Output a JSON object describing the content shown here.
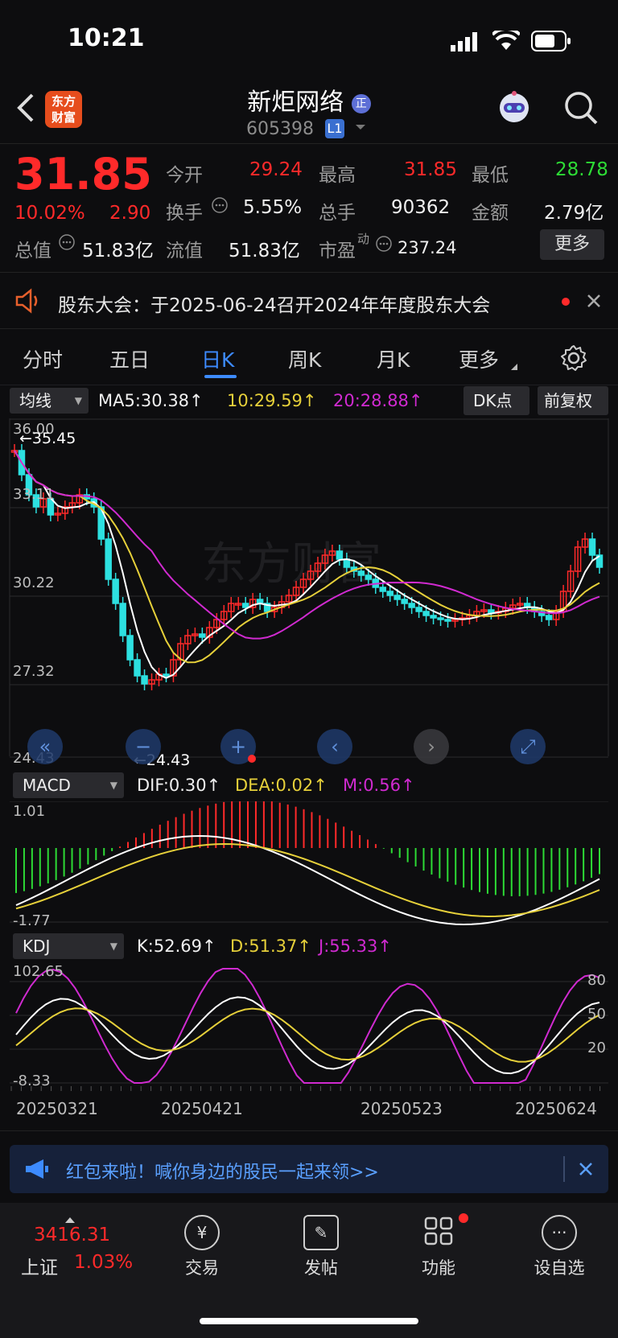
{
  "status": {
    "time": "10:21"
  },
  "header": {
    "logo": "东方\n财富",
    "title": "新炬网络",
    "code": "605398",
    "level": "L1"
  },
  "quote": {
    "price": "31.85",
    "change_pct": "10.02%",
    "change": "2.90",
    "fields": [
      {
        "label": "今开",
        "value": "29.24"
      },
      {
        "label": "最高",
        "value": "31.85"
      },
      {
        "label": "最低",
        "value": "28.78"
      },
      {
        "label": "换手",
        "value": "5.55%"
      },
      {
        "label": "总手",
        "value": "90362"
      },
      {
        "label": "金额",
        "value": "2.79亿"
      },
      {
        "label": "总值",
        "value": "51.83亿"
      },
      {
        "label": "流值",
        "value": "51.83亿"
      },
      {
        "label": "市盈",
        "sup": "动",
        "value": "237.24"
      }
    ],
    "more": "更多"
  },
  "notice": {
    "text": "股东大会：于2025-06-24召开2024年年度股东大会"
  },
  "tabs": [
    "分时",
    "五日",
    "日K",
    "周K",
    "月K",
    "更多"
  ],
  "active_tab": "日K",
  "kline": {
    "selector": "均线",
    "ma5": "MA5:30.38↑",
    "ma10": "10:29.59↑",
    "ma20": "20:28.88↑",
    "dk": "DK点",
    "adjust": "前复权",
    "y_labels": [
      "36.00",
      "33.11",
      "30.22",
      "27.32",
      "24.43"
    ],
    "high_mark": "←35.45",
    "low_mark": "←24.43",
    "watermark": "东方财富"
  },
  "macd": {
    "selector": "MACD",
    "dif": "DIF:0.30↑",
    "dea": "DEA:0.02↑",
    "m": "M:0.56↑",
    "y_top": "1.01",
    "y_bottom": "-1.77"
  },
  "kdj": {
    "selector": "KDJ",
    "k": "K:52.69↑",
    "d": "D:51.37↑",
    "j": "J:55.33↑",
    "y_top": "102.65",
    "y_bottom": "-8.33",
    "levels": [
      "80",
      "50",
      "20"
    ]
  },
  "dates": [
    "20250321",
    "20250421",
    "20250523",
    "20250624"
  ],
  "promo": {
    "text": "红包来啦！喊你身边的股民一起来领>>"
  },
  "bottom": {
    "index_value": "3416.31",
    "index_name": "上证",
    "index_pct": "1.03%",
    "items": [
      "交易",
      "发帖",
      "功能",
      "设自选"
    ]
  },
  "colors": {
    "up": "#ff2a2a",
    "down": "#2de0e0",
    "ma5": "#ffffff",
    "ma10": "#e6d03a",
    "ma20": "#d02ad0",
    "active": "#3d8bff"
  }
}
